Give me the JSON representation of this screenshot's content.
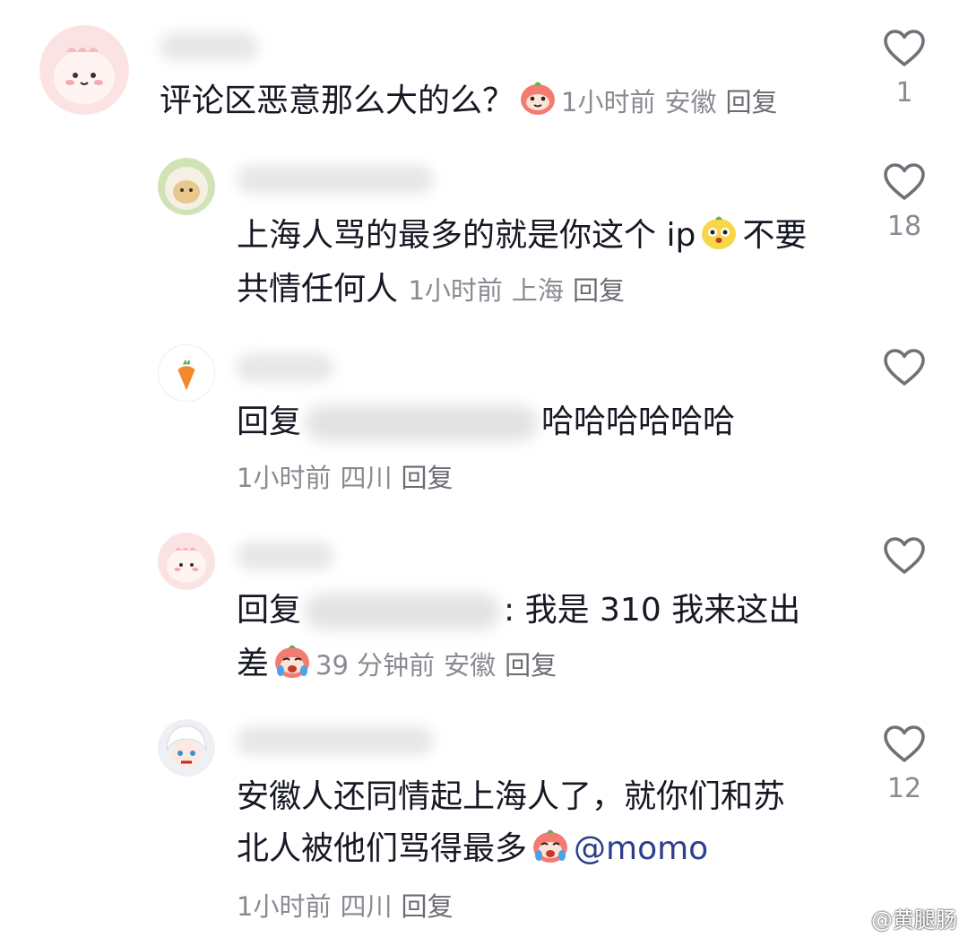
{
  "comments": [
    {
      "text_parts": [
        "评论区恶意那么大的么？"
      ],
      "time": "1小时前",
      "location": "安徽",
      "reply_label": "回复",
      "likes": "1",
      "avatar_icon": "pink-creature-avatar",
      "emoji_icon": "smile-emoji"
    },
    {
      "line1": "上海人骂的最多的就是你这个 ip",
      "line1_tail": "不要",
      "line2": "共情任何人",
      "time": "1小时前",
      "location": "上海",
      "reply_label": "回复",
      "likes": "18",
      "avatar_icon": "sheep-avatar",
      "emoji_icon": "surprised-emoji"
    },
    {
      "prefix": "回复",
      "text": "哈哈哈哈哈哈",
      "time": "1小时前",
      "location": "四川",
      "reply_label": "回复",
      "likes": "",
      "avatar_icon": "carrot-avatar"
    },
    {
      "prefix": "回复",
      "text": ": 我是 310 我来这出",
      "line2": "差",
      "time": "39 分钟前",
      "location": "安徽",
      "reply_label": "回复",
      "likes": "",
      "avatar_icon": "pink-creature-avatar",
      "emoji_icon": "crying-emoji"
    },
    {
      "line1": "安徽人还同情起上海人了，就你们和苏",
      "line2": "北人被他们骂得最多",
      "mention": "@momo",
      "time": "1小时前",
      "location": "四川",
      "reply_label": "回复",
      "likes": "12",
      "avatar_icon": "anime-girl-avatar",
      "emoji_icon": "crying-emoji"
    }
  ],
  "watermark": "@黄腿肠",
  "colors": {
    "text": "#161823",
    "meta": "#8a8a92",
    "mention": "#2c3e8f"
  }
}
